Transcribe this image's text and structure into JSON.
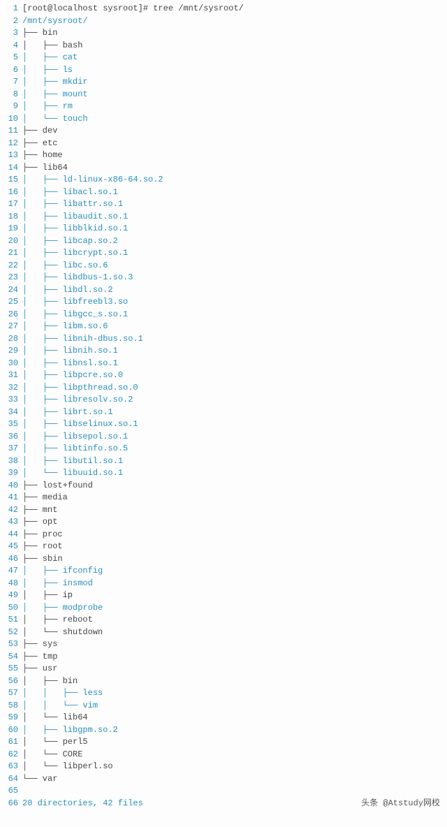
{
  "prompt": "[root@localhost sysroot]# tree /mnt/sysroot/",
  "root": "/mnt/sysroot/",
  "lines": [
    {
      "n": 1,
      "cls": "tx",
      "t": "[root@localhost sysroot]# tree /mnt/sysroot/"
    },
    {
      "n": 2,
      "cls": "tx-b",
      "t": "/mnt/sysroot/"
    },
    {
      "n": 3,
      "cls": "tx",
      "t": "├── bin"
    },
    {
      "n": 4,
      "cls": "tx",
      "t": "│   ├── bash"
    },
    {
      "n": 5,
      "cls": "tx-b",
      "t": "│   ├── cat"
    },
    {
      "n": 6,
      "cls": "tx-b",
      "t": "│   ├── ls"
    },
    {
      "n": 7,
      "cls": "tx-b",
      "t": "│   ├── mkdir"
    },
    {
      "n": 8,
      "cls": "tx-b",
      "t": "│   ├── mount"
    },
    {
      "n": 9,
      "cls": "tx-b",
      "t": "│   ├── rm"
    },
    {
      "n": 10,
      "cls": "tx-b",
      "t": "│   └── touch"
    },
    {
      "n": 11,
      "cls": "tx",
      "t": "├── dev"
    },
    {
      "n": 12,
      "cls": "tx",
      "t": "├── etc"
    },
    {
      "n": 13,
      "cls": "tx",
      "t": "├── home"
    },
    {
      "n": 14,
      "cls": "tx",
      "t": "├── lib64"
    },
    {
      "n": 15,
      "cls": "tx-b",
      "t": "│   ├── ld-linux-x86-64.so.2"
    },
    {
      "n": 16,
      "cls": "tx-b",
      "t": "│   ├── libacl.so.1"
    },
    {
      "n": 17,
      "cls": "tx-b",
      "t": "│   ├── libattr.so.1"
    },
    {
      "n": 18,
      "cls": "tx-b",
      "t": "│   ├── libaudit.so.1"
    },
    {
      "n": 19,
      "cls": "tx-b",
      "t": "│   ├── libblkid.so.1"
    },
    {
      "n": 20,
      "cls": "tx-b",
      "t": "│   ├── libcap.so.2"
    },
    {
      "n": 21,
      "cls": "tx-b",
      "t": "│   ├── libcrypt.so.1"
    },
    {
      "n": 22,
      "cls": "tx-b",
      "t": "│   ├── libc.so.6"
    },
    {
      "n": 23,
      "cls": "tx-b",
      "t": "│   ├── libdbus-1.so.3"
    },
    {
      "n": 24,
      "cls": "tx-b",
      "t": "│   ├── libdl.so.2"
    },
    {
      "n": 25,
      "cls": "tx-b",
      "t": "│   ├── libfreebl3.so"
    },
    {
      "n": 26,
      "cls": "tx-b",
      "t": "│   ├── libgcc_s.so.1"
    },
    {
      "n": 27,
      "cls": "tx-b",
      "t": "│   ├── libm.so.6"
    },
    {
      "n": 28,
      "cls": "tx-b",
      "t": "│   ├── libnih-dbus.so.1"
    },
    {
      "n": 29,
      "cls": "tx-b",
      "t": "│   ├── libnih.so.1"
    },
    {
      "n": 30,
      "cls": "tx-b",
      "t": "│   ├── libnsl.so.1"
    },
    {
      "n": 31,
      "cls": "tx-b",
      "t": "│   ├── libpcre.so.0"
    },
    {
      "n": 32,
      "cls": "tx-b",
      "t": "│   ├── libpthread.so.0"
    },
    {
      "n": 33,
      "cls": "tx-b",
      "t": "│   ├── libresolv.so.2"
    },
    {
      "n": 34,
      "cls": "tx-b",
      "t": "│   ├── librt.so.1"
    },
    {
      "n": 35,
      "cls": "tx-b",
      "t": "│   ├── libselinux.so.1"
    },
    {
      "n": 36,
      "cls": "tx-b",
      "t": "│   ├── libsepol.so.1"
    },
    {
      "n": 37,
      "cls": "tx-b",
      "t": "│   ├── libtinfo.so.5"
    },
    {
      "n": 38,
      "cls": "tx-b",
      "t": "│   ├── libutil.so.1"
    },
    {
      "n": 39,
      "cls": "tx-b",
      "t": "│   └── libuuid.so.1"
    },
    {
      "n": 40,
      "cls": "tx",
      "t": "├── lost+found"
    },
    {
      "n": 41,
      "cls": "tx",
      "t": "├── media"
    },
    {
      "n": 42,
      "cls": "tx",
      "t": "├── mnt"
    },
    {
      "n": 43,
      "cls": "tx",
      "t": "├── opt"
    },
    {
      "n": 44,
      "cls": "tx",
      "t": "├── proc"
    },
    {
      "n": 45,
      "cls": "tx",
      "t": "├── root"
    },
    {
      "n": 46,
      "cls": "tx",
      "t": "├── sbin"
    },
    {
      "n": 47,
      "cls": "tx-b",
      "t": "│   ├── ifconfig"
    },
    {
      "n": 48,
      "cls": "tx-b",
      "t": "│   ├── insmod"
    },
    {
      "n": 49,
      "cls": "tx",
      "t": "│   ├── ip"
    },
    {
      "n": 50,
      "cls": "tx-b",
      "t": "│   ├── modprobe"
    },
    {
      "n": 51,
      "cls": "tx",
      "t": "│   ├── reboot"
    },
    {
      "n": 52,
      "cls": "tx",
      "t": "│   └── shutdown"
    },
    {
      "n": 53,
      "cls": "tx",
      "t": "├── sys"
    },
    {
      "n": 54,
      "cls": "tx",
      "t": "├── tmp"
    },
    {
      "n": 55,
      "cls": "tx",
      "t": "├── usr"
    },
    {
      "n": 56,
      "cls": "tx",
      "t": "│   ├── bin"
    },
    {
      "n": 57,
      "cls": "tx-b",
      "t": "│   │   ├── less"
    },
    {
      "n": 58,
      "cls": "tx-b",
      "t": "│   │   └── vim"
    },
    {
      "n": 59,
      "cls": "tx",
      "t": "│   └── lib64"
    },
    {
      "n": 60,
      "cls": "tx-b",
      "t": "│   ├── libgpm.so.2"
    },
    {
      "n": 61,
      "cls": "tx",
      "t": "│   └── perl5"
    },
    {
      "n": 62,
      "cls": "tx",
      "t": "│   └── CORE"
    },
    {
      "n": 63,
      "cls": "tx",
      "t": "│   └── libperl.so"
    },
    {
      "n": 64,
      "cls": "tx",
      "t": "└── var"
    },
    {
      "n": 65,
      "cls": "tx",
      "t": ""
    },
    {
      "n": 66,
      "cls": "tx-b",
      "t": "20 directories, 42 files"
    }
  ],
  "summary": {
    "directories": 20,
    "files": 42,
    "text": "20 directories, 42 files"
  },
  "footer": "头条 @Atstudy网校"
}
